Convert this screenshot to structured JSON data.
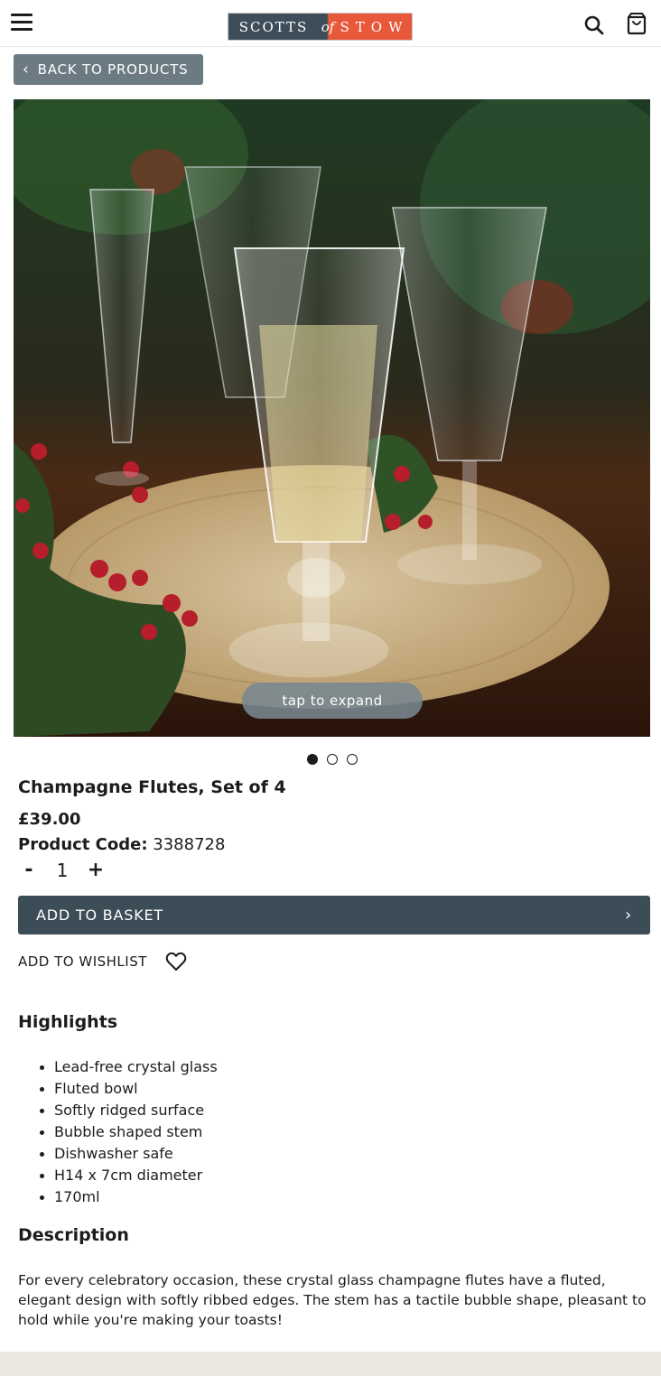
{
  "header": {
    "logo": {
      "left": "SCOTTS",
      "mid": "of",
      "right": "STOW"
    },
    "icons": [
      "menu-icon",
      "search-icon",
      "basket-icon"
    ]
  },
  "nav": {
    "back_label": "BACK TO PRODUCTS"
  },
  "gallery": {
    "expand_label": "tap to expand",
    "slide_count": 3,
    "active_slide": 1
  },
  "product": {
    "title": "Champagne Flutes, Set of 4",
    "price": "£39.00",
    "code_label": "Product Code:",
    "code_value": "3388728",
    "quantity": "1",
    "minus_label": "-",
    "plus_label": "+",
    "add_to_basket": "ADD TO BASKET",
    "add_to_wishlist": "ADD TO WISHLIST"
  },
  "highlights": {
    "heading": "Highlights",
    "items": [
      "Lead-free crystal glass",
      "Fluted bowl",
      "Softly ridged surface",
      "Bubble shaped stem",
      "Dishwasher safe",
      "H14 x 7cm diameter",
      "170ml"
    ]
  },
  "description": {
    "heading": "Description",
    "text": "For every celebratory occasion, these crystal glass champagne flutes have a fluted, elegant design with softly ribbed edges. The stem has a tactile bubble shape, pleasant to hold while you're making your toasts!"
  },
  "colors": {
    "primary": "#3c4d58",
    "back_button": "#6c7a83",
    "logo_accent": "#e8583a",
    "footer": "#ebe8e2"
  }
}
